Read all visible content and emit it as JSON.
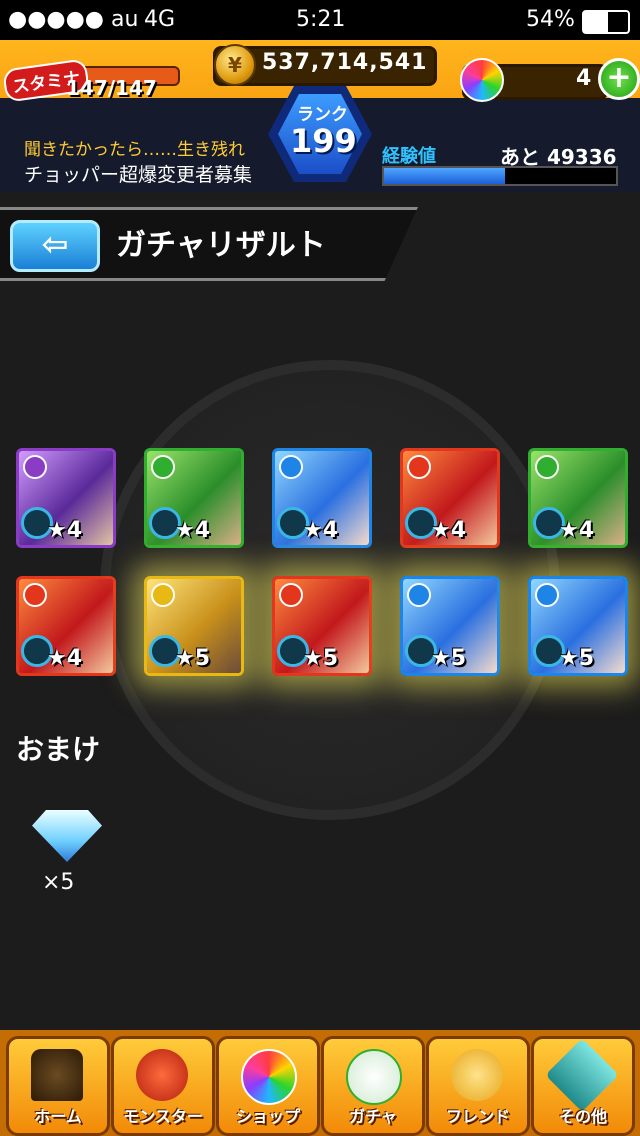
{
  "status": {
    "carrier": "●●●●● au",
    "network": "4G",
    "time": "5:21",
    "battery": "54%"
  },
  "header": {
    "stamina_label": "スタミナ",
    "stamina_value": "147/147",
    "coins": "537,714,541",
    "orbs": "4",
    "rank_label": "ランク",
    "rank": "199",
    "message1": "聞きたかったら……生き残れ",
    "message2": "チョッパー超爆変更者募集",
    "exp_label": "経験値",
    "exp_remaining": "あと 49336",
    "exp_progress": 0.52
  },
  "page": {
    "title": "ガチャリザルト",
    "back_icon": "back-arrow-icon"
  },
  "results": [
    {
      "stars": "★4",
      "element": "dark",
      "rarity": 4
    },
    {
      "stars": "★4",
      "element": "wood",
      "rarity": 4
    },
    {
      "stars": "★4",
      "element": "water",
      "rarity": 4
    },
    {
      "stars": "★4",
      "element": "fire",
      "rarity": 4
    },
    {
      "stars": "★4",
      "element": "wood",
      "rarity": 4
    },
    {
      "stars": "★4",
      "element": "fire",
      "rarity": 4
    },
    {
      "stars": "★5",
      "element": "light",
      "rarity": 5
    },
    {
      "stars": "★5",
      "element": "fire",
      "rarity": 5
    },
    {
      "stars": "★5",
      "element": "water",
      "rarity": 5
    },
    {
      "stars": "★5",
      "element": "water",
      "rarity": 5
    }
  ],
  "bonus": {
    "label": "おまけ",
    "item_icon": "diamond-icon",
    "quantity": "×5"
  },
  "nav": [
    {
      "label": "ホーム",
      "icon": "home-gate-icon"
    },
    {
      "label": "モンスター",
      "icon": "monster-icon"
    },
    {
      "label": "ショップ",
      "icon": "orb-icon"
    },
    {
      "label": "ガチャ",
      "icon": "egg-icon"
    },
    {
      "label": "フレンド",
      "icon": "friends-icon"
    },
    {
      "label": "その他",
      "icon": "other-icon"
    }
  ],
  "colors": {
    "fire": "#e2371c",
    "water": "#1e84e6",
    "wood": "#2fae2f",
    "light": "#e8b814",
    "dark": "#8a3cc4"
  }
}
